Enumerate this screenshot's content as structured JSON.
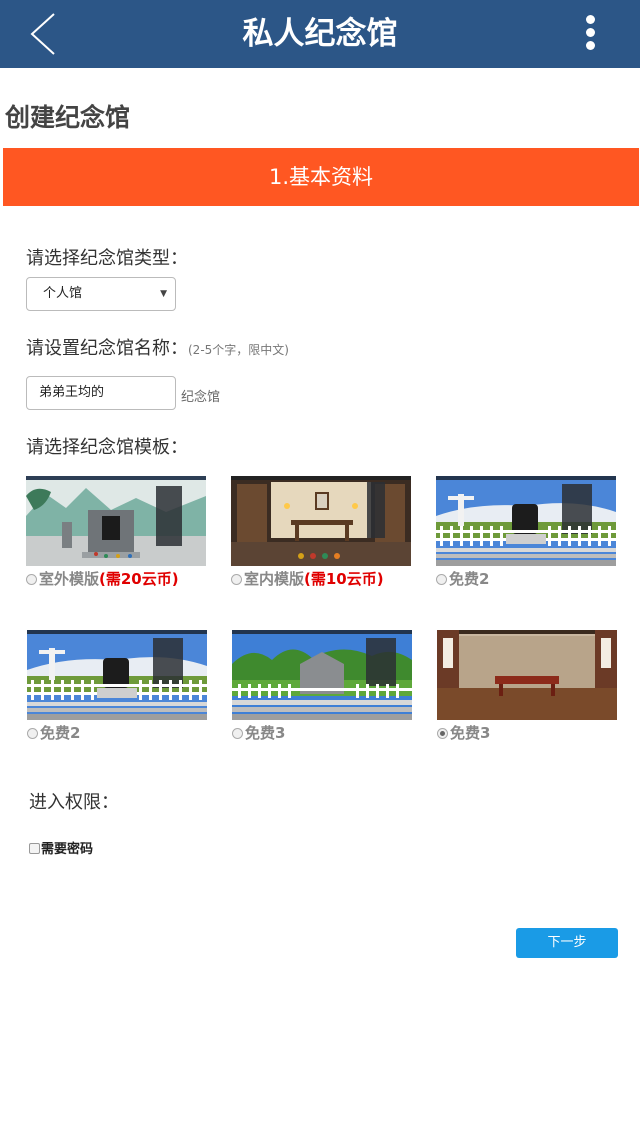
{
  "header": {
    "title": "私人纪念馆",
    "back_icon": "chevron-left-icon",
    "menu_icon": "more-vertical-icon",
    "bg_color": "#2c5687"
  },
  "page": {
    "heading": "创建纪念馆"
  },
  "step": {
    "label": "1.基本资料",
    "color": "#ff5722"
  },
  "form": {
    "type": {
      "label": "请选择纪念馆类型：",
      "selected": "个人馆"
    },
    "name": {
      "label": "请设置纪念馆名称：",
      "hint": "(2-5个字，限中文)",
      "value": "弟弟王均的",
      "suffix": "纪念馆"
    },
    "template": {
      "label": "请选择纪念馆模板：",
      "options": [
        {
          "name": "室外模版",
          "price": "(需20云币)",
          "scene": "outdoor",
          "checked": false
        },
        {
          "name": "室内模版",
          "price": "(需10云币)",
          "scene": "indoor",
          "checked": false
        },
        {
          "name": "免费2",
          "price": "",
          "scene": "christ",
          "checked": false
        },
        {
          "name": "免费2",
          "price": "",
          "scene": "christ",
          "checked": false
        },
        {
          "name": "免费3",
          "price": "",
          "scene": "stone",
          "checked": false
        },
        {
          "name": "免费3",
          "price": "",
          "scene": "hall",
          "checked": true
        }
      ]
    },
    "access": {
      "label": "进入权限：",
      "password_label": "需要密码",
      "password_required": false
    }
  },
  "actions": {
    "next_label": "下一步",
    "accent": "#1a9be6",
    "price_color": "#e00000"
  }
}
